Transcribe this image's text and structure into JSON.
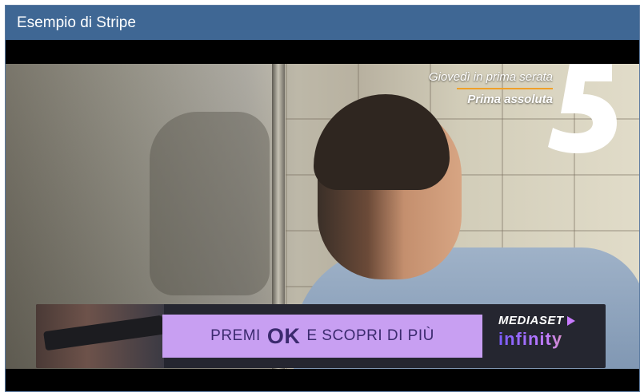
{
  "window": {
    "title": "Esempio di Stripe"
  },
  "video": {
    "promo": {
      "line1": "Giovedì in prima serata",
      "line2": "Prima assoluta",
      "accent_color": "#f0a028"
    },
    "channel_logo": {
      "icon": "canale5-logo-icon",
      "text": "5"
    }
  },
  "banner": {
    "cta_prefix": "PREMI",
    "cta_key": "OK",
    "cta_suffix": "E SCOPRI DI PIÙ",
    "cta_color": "#c89ff2",
    "brand_top": "MEDIASET",
    "brand_bottom": "infinity",
    "brand_icon": "play-icon"
  }
}
